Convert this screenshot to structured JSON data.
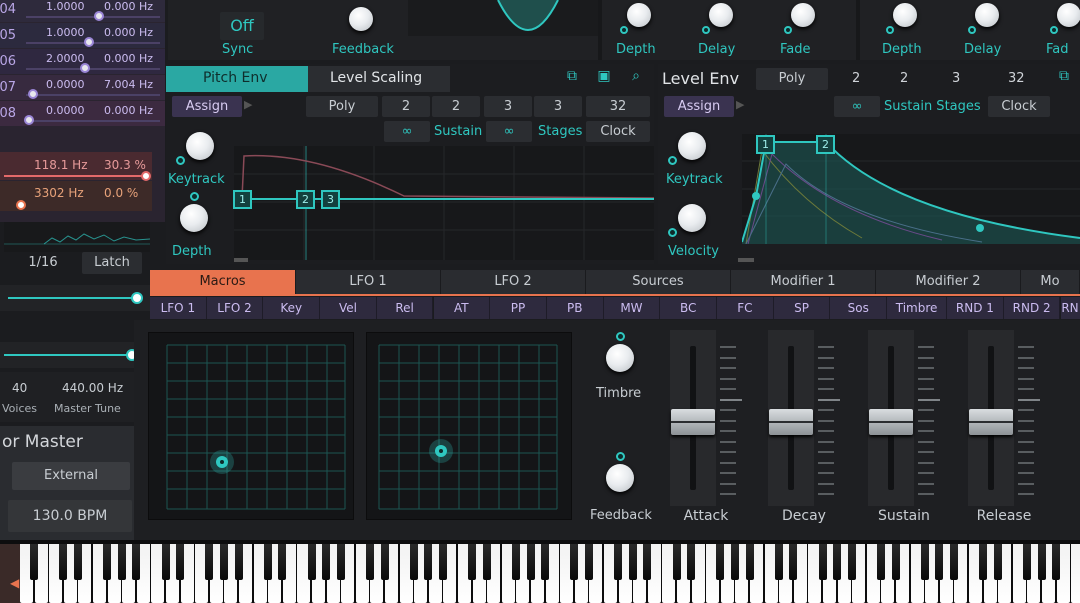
{
  "partials": [
    {
      "num": "04",
      "ratio": "1.0000",
      "freq": "0.000 Hz"
    },
    {
      "num": "05",
      "ratio": "1.0000",
      "freq": "0.000 Hz"
    },
    {
      "num": "06",
      "ratio": "2.0000",
      "freq": "0.000 Hz"
    },
    {
      "num": "07",
      "ratio": "0.0000",
      "freq": "7.004 Hz"
    },
    {
      "num": "08",
      "ratio": "0.0000",
      "freq": "0.000 Hz"
    }
  ],
  "filters": [
    {
      "freq": "118.1 Hz",
      "pct": "30.3 %"
    },
    {
      "freq": "3302 Hz",
      "pct": "0.0 %"
    }
  ],
  "arp": {
    "rate": "1/16",
    "latch": "Latch"
  },
  "global": {
    "voices_value": "40",
    "voices_label": "Voices",
    "tune_value": "440.00 Hz",
    "tune_label": "Master Tune"
  },
  "clock": {
    "title": "or Master",
    "source": "External",
    "bpm": "130.0 BPM"
  },
  "top": {
    "sync_value": "Off",
    "sync_label": "Sync",
    "feedback_label": "Feedback",
    "knobs_a": [
      "Depth",
      "Delay",
      "Fade"
    ],
    "knobs_b": [
      "Depth",
      "Delay",
      "Fad"
    ]
  },
  "pitch_env": {
    "tab_active": "Pitch Env",
    "tab_other": "Level Scaling",
    "assign": "Assign",
    "poly": "Poly",
    "nums": [
      "2",
      "2",
      "3",
      "3",
      "32"
    ],
    "sustain": "Sustain",
    "stages": "Stages",
    "clock": "Clock",
    "keytrack": "Keytrack",
    "depth": "Depth",
    "nodes": [
      "1",
      "2",
      "3"
    ]
  },
  "level_env": {
    "title": "Level Env",
    "poly": "Poly",
    "nums": [
      "2",
      "2",
      "3",
      "32"
    ],
    "assign": "Assign",
    "sustain_stages": "Sustain Stages",
    "clock": "Clock",
    "keytrack": "Keytrack",
    "velocity": "Velocity",
    "nodes": [
      "1",
      "2"
    ]
  },
  "mod_tabs": [
    "Macros",
    "LFO 1",
    "LFO 2",
    "Sources",
    "Modifier 1",
    "Modifier 2",
    "Mo"
  ],
  "mod_sources": [
    "LFO 1",
    "LFO 2",
    "Key",
    "Vel",
    "Rel",
    "AT",
    "PP",
    "PB",
    "MW",
    "BC",
    "FC",
    "SP",
    "Sos",
    "Timbre",
    "RND 1",
    "RND 2",
    "RN"
  ],
  "macros": {
    "timbre": "Timbre",
    "feedback": "Feedback",
    "faders": [
      "Attack",
      "Decay",
      "Sustain",
      "Release"
    ],
    "fader_levels": [
      0.47,
      0.47,
      0.47,
      0.47
    ]
  },
  "colors": {
    "accent": "#2fc7c0",
    "active_tab": "#e8734e",
    "mod_purple": "#cbbcf0"
  }
}
